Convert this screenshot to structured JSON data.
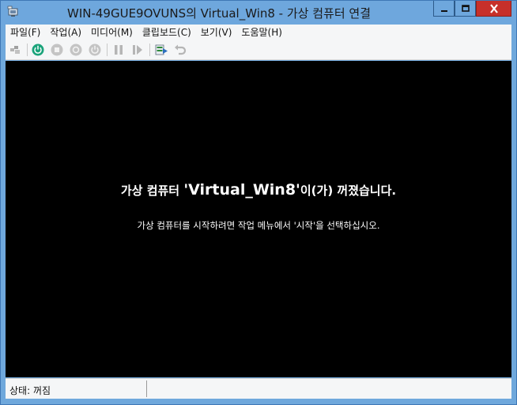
{
  "window": {
    "title": "WIN-49GUE9OVUNS의 Virtual_Win8 - 가상 컴퓨터 연결",
    "controls": {
      "minimize": "minimize-icon",
      "maximize": "maximize-icon",
      "close": "close-icon"
    }
  },
  "menu": {
    "items": [
      "파일(F)",
      "작업(A)",
      "미디어(M)",
      "클립보드(C)",
      "보기(V)",
      "도움말(H)"
    ]
  },
  "toolbar": {
    "buttons": [
      "ctrl-alt-del-icon",
      "start-icon",
      "turn-off-icon",
      "shut-down-icon",
      "save-icon",
      "pause-icon",
      "reset-icon",
      "checkpoint-icon",
      "revert-icon"
    ],
    "colors": {
      "start": "#1aa37a",
      "disabled": "#a8a8a8"
    }
  },
  "screen": {
    "message_prefix": "가상 컴퓨터 ",
    "vm_name": "'Virtual_Win8'",
    "message_suffix": "이(가) 꺼졌습니다.",
    "instruction": "가상 컴퓨터를 시작하려면 작업 메뉴에서 '시작'을 선택하십시오."
  },
  "status": {
    "text": "상태: 꺼짐"
  }
}
